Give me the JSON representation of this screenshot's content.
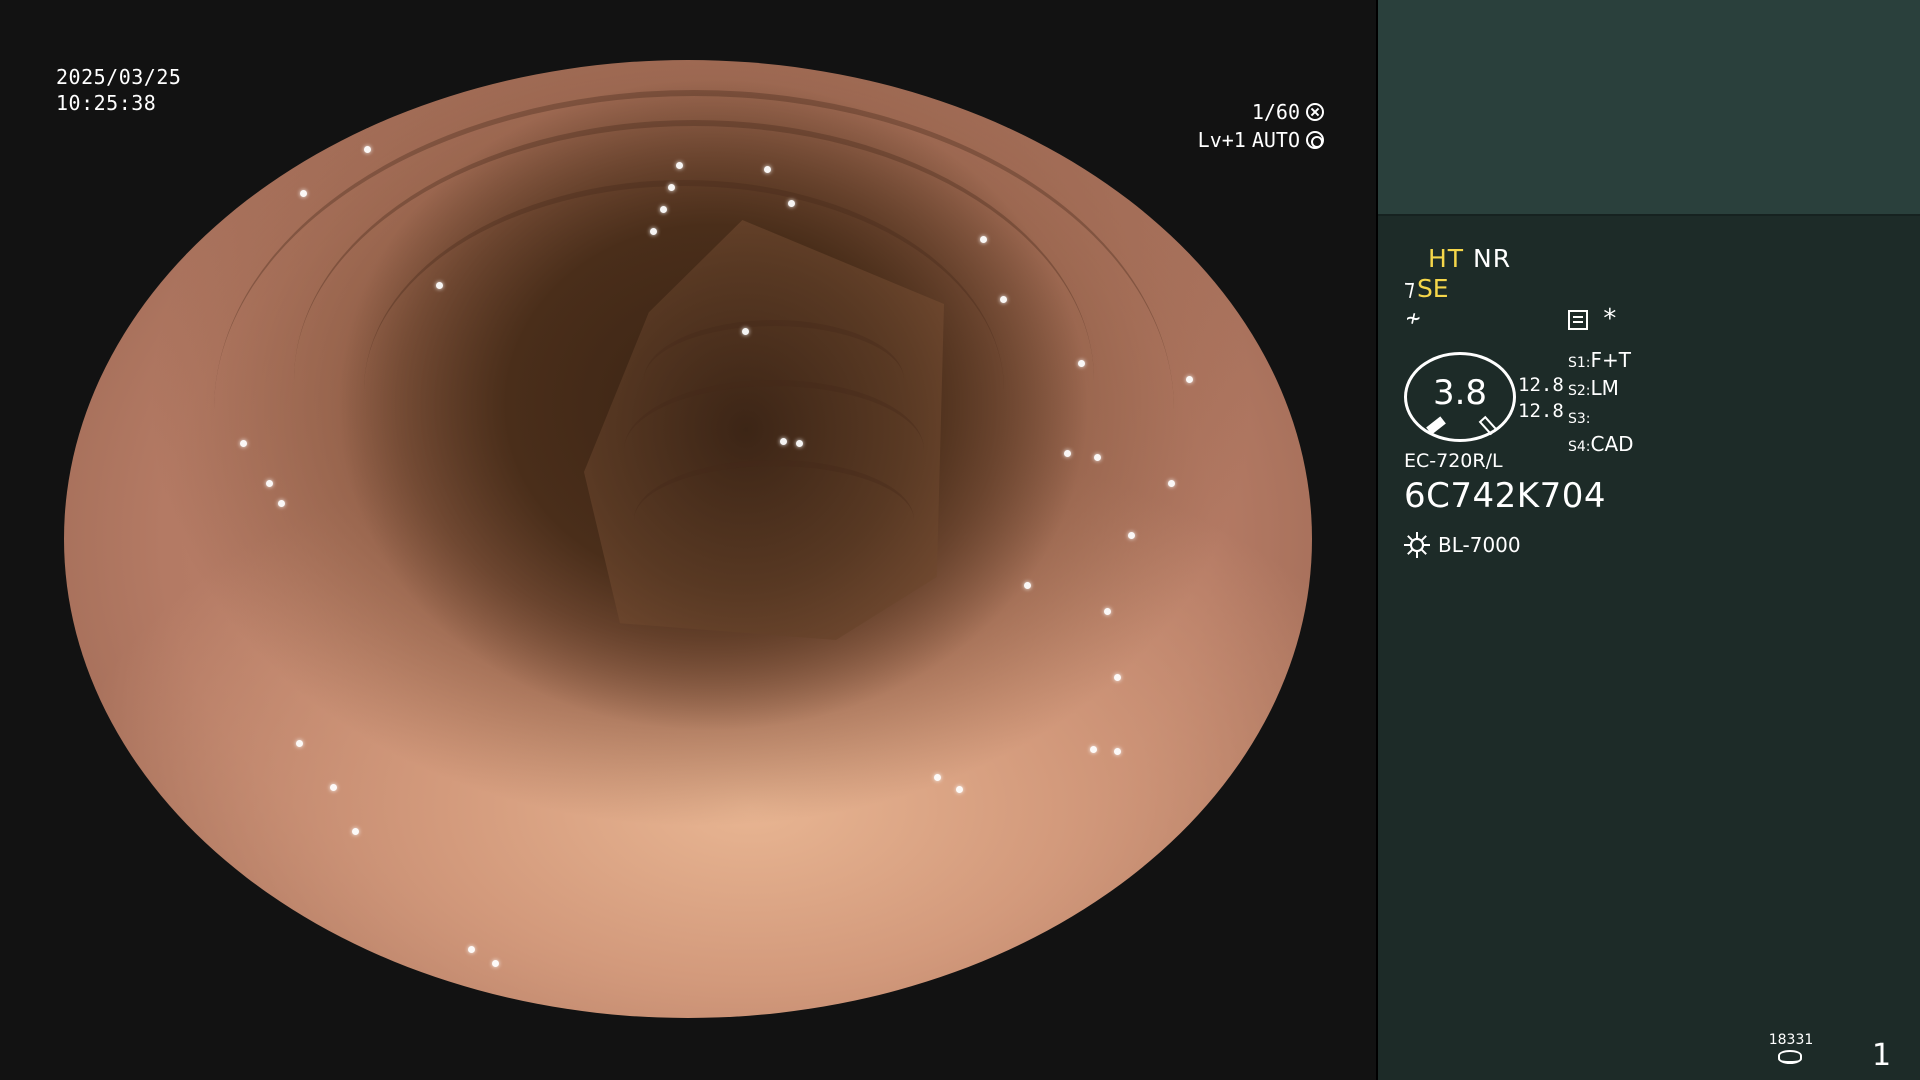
{
  "overlay": {
    "date": "2025/03/25",
    "time": "10:25:38",
    "shutter": "1/60",
    "level": "Lv+1",
    "exposure_mode": "AUTO"
  },
  "panel": {
    "mode_ht": "HT",
    "mode_nr": "NR",
    "mode_se": "SE",
    "gauge_value": "3.8",
    "gauge_side_1": "12.8",
    "gauge_side_2": "12.8",
    "softkeys": [
      {
        "key": "S1:",
        "value": "F+T"
      },
      {
        "key": "S2:",
        "value": "LM"
      },
      {
        "key": "S3:",
        "value": ""
      },
      {
        "key": "S4:",
        "value": "CAD"
      }
    ],
    "scope_model": "EC-720R/L",
    "serial": "6C742K704",
    "light_source": "BL-7000",
    "counter": "18331",
    "page": "1"
  },
  "colors": {
    "panel_bg": "#1d2b28",
    "panel_top": "#2a403c",
    "highlight_yellow": "#f5d64a"
  },
  "icons": [
    "shutter-icon",
    "auto-iris-icon",
    "structure-icon",
    "color-enhance-icon",
    "memo-icon",
    "light-source-icon",
    "disk-icon"
  ]
}
